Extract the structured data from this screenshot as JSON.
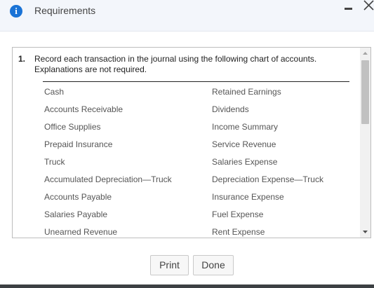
{
  "dialog": {
    "title": "Requirements",
    "icons": {
      "info": "info-icon",
      "minimize": "minimize-icon",
      "close": "close-icon"
    }
  },
  "requirement": {
    "number": "1.",
    "text": "Record each transaction in the journal using the following chart of accounts. Explanations are not required."
  },
  "accounts_left": [
    "Cash",
    "Accounts Receivable",
    "Office Supplies",
    "Prepaid Insurance",
    "Truck",
    "Accumulated Depreciation—Truck",
    "Accounts Payable",
    "Salaries Payable",
    "Unearned Revenue"
  ],
  "accounts_right": [
    "Retained Earnings",
    "Dividends",
    "Income Summary",
    "Service Revenue",
    "Salaries Expense",
    "Depreciation Expense—Truck",
    "Insurance Expense",
    "Fuel Expense",
    "Rent Expense"
  ],
  "buttons": {
    "print": "Print",
    "done": "Done"
  },
  "colors": {
    "accent": "#1a73d6",
    "titlebar_bg": "#f3f6fb"
  }
}
